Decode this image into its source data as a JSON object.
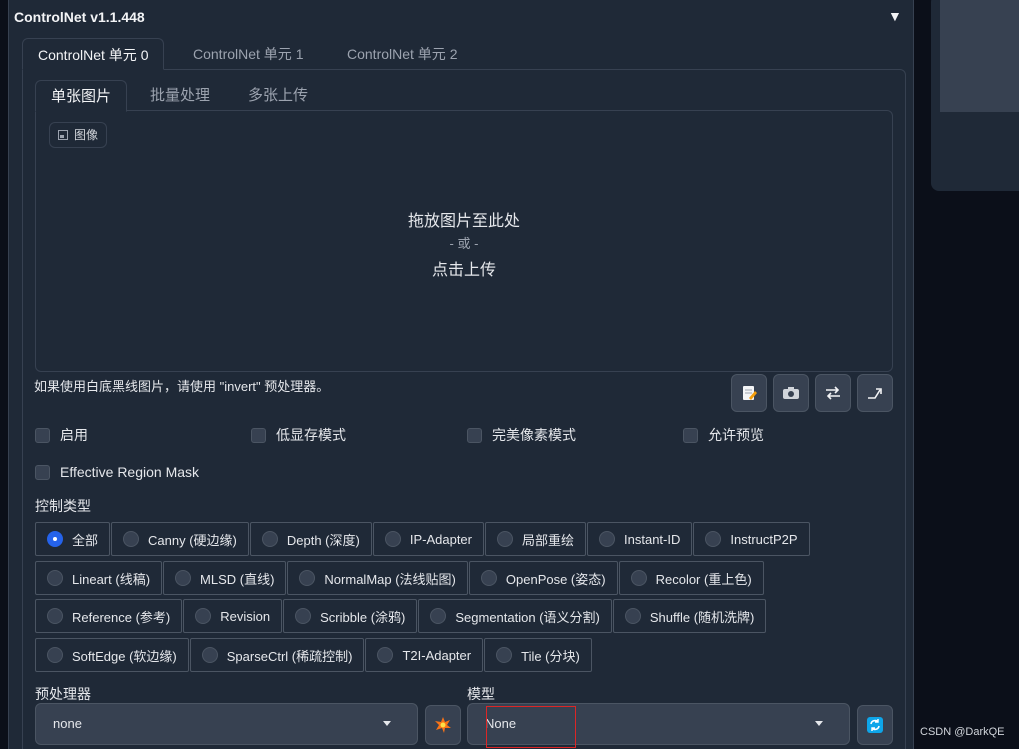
{
  "accordion": {
    "title": "ControlNet v1.1.448",
    "toggle": "▼"
  },
  "unit_tabs": [
    "ControlNet 单元 0",
    "ControlNet 单元 1",
    "ControlNet 单元 2"
  ],
  "image_tabs": [
    "单张图片",
    "批量处理",
    "多张上传"
  ],
  "dropzone": {
    "label": "图像",
    "main": "拖放图片至此处",
    "or": "- 或 -",
    "click": "点击上传"
  },
  "hint": "如果使用白底黑线图片，请使用 \"invert\" 预处理器。",
  "tool_buttons": [
    "edit-icon",
    "camera-icon",
    "swap-icon",
    "send-icon"
  ],
  "checkboxes": {
    "enable": "启用",
    "low_vram": "低显存模式",
    "pixel_perfect": "完美像素模式",
    "allow_preview": "允许预览",
    "region_mask": "Effective Region Mask"
  },
  "control_type": {
    "label": "控制类型",
    "selected": "全部",
    "rows": [
      [
        "全部",
        "Canny (硬边缘)",
        "Depth (深度)",
        "IP-Adapter",
        "局部重绘",
        "Instant-ID",
        "InstructP2P"
      ],
      [
        "Lineart (线稿)",
        "MLSD (直线)",
        "NormalMap (法线贴图)",
        "OpenPose (姿态)",
        "Recolor (重上色)"
      ],
      [
        "Reference (参考)",
        "Revision",
        "Scribble (涂鸦)",
        "Segmentation (语义分割)",
        "Shuffle (随机洗牌)"
      ],
      [
        "SoftEdge (软边缘)",
        "SparseCtrl (稀疏控制)",
        "T2I-Adapter",
        "Tile (分块)"
      ]
    ]
  },
  "preprocessor": {
    "label": "预处理器",
    "value": "none"
  },
  "model": {
    "label": "模型",
    "value": "None"
  },
  "watermark": "CSDN @DarkQE",
  "colors": {
    "accent": "#2563eb",
    "panel": "#1f2937",
    "background": "#0b0f19",
    "highlight": "#dc2626"
  }
}
